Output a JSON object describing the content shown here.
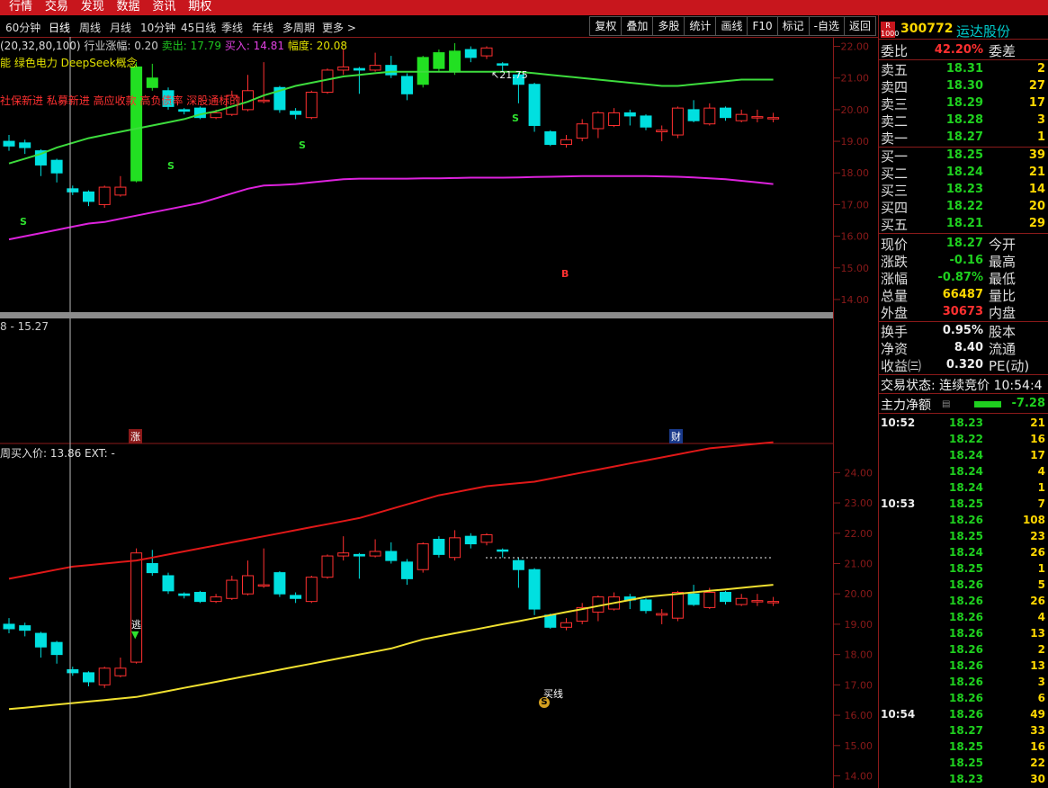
{
  "top_menu": [
    "行情",
    "交易",
    "发现",
    "数据",
    "资讯",
    "期权"
  ],
  "periods": [
    "60分钟",
    "日线",
    "周线",
    "月线",
    "10分钟",
    "45日线",
    "季线",
    "年线",
    "多周期",
    "更多 >"
  ],
  "active_period": "日线",
  "tools": [
    "复权",
    "叠加",
    "多股",
    "统计",
    "画线",
    "F10",
    "标记",
    "-自选",
    "返回"
  ],
  "indicator_line": {
    "params": "(20,32,80,100)",
    "industry_label": "行业涨幅: 0.20",
    "sell_label": "卖出: 17.79",
    "buy_label": "买入: 14.81",
    "range_label": "幅度: 20.08"
  },
  "concept_line": "能 绿色电力 DeepSeek概念",
  "tags_line": "社保新进 私募新进 高应收款 高负债率 深股通标的",
  "upper_low_label": "8 - 15.27",
  "lower_info": "周买入价: 13.86  EXT: -",
  "markers": {
    "high": "21.75",
    "s": "S",
    "b": "B",
    "zhang": "涨",
    "cai": "财",
    "tao": "逃",
    "mai": "买线",
    "low_s": "S"
  },
  "colors": {
    "up": "#ff3030",
    "down": "#00e0e0",
    "green_up": "#22e022",
    "ma_green": "#3ddc3d",
    "ma_magenta": "#dd22dd",
    "ma_red": "#e01818",
    "ma_yellow": "#f0e030",
    "axis": "#8b1a1a"
  },
  "upper_axis": {
    "ticks": [
      "22.00",
      "21.00",
      "20.00",
      "19.00",
      "18.00",
      "17.00",
      "16.00",
      "15.00",
      "14.00"
    ],
    "values": [
      22,
      21,
      20,
      19,
      18,
      17,
      16,
      15,
      14
    ]
  },
  "lower_axis": {
    "ticks": [
      "24.00",
      "23.00",
      "22.00",
      "21.00",
      "20.00",
      "19.00",
      "18.00",
      "17.00",
      "16.00",
      "15.00",
      "14.00"
    ],
    "values": [
      24,
      23,
      22,
      21,
      20,
      19,
      18,
      17,
      16,
      15,
      14
    ]
  },
  "chart_data": {
    "type": "candlestick",
    "upper_ylim": [
      13.6,
      22.3
    ],
    "lower_ylim": [
      13.6,
      24.9
    ],
    "candles": [
      [
        19.0,
        18.85,
        19.2,
        18.7
      ],
      [
        18.95,
        18.8,
        19.05,
        18.6
      ],
      [
        18.7,
        18.25,
        18.75,
        17.9
      ],
      [
        18.4,
        18.0,
        18.45,
        17.7
      ],
      [
        17.5,
        17.4,
        17.6,
        17.3
      ],
      [
        17.4,
        17.1,
        17.45,
        16.95
      ],
      [
        17.0,
        17.55,
        17.6,
        16.9
      ],
      [
        17.3,
        17.55,
        17.9,
        17.25
      ],
      [
        17.75,
        21.35,
        21.5,
        17.7
      ],
      [
        21.0,
        20.7,
        21.45,
        20.6
      ],
      [
        20.6,
        20.1,
        20.7,
        20.0
      ],
      [
        20.0,
        19.95,
        20.05,
        19.85
      ],
      [
        20.05,
        19.75,
        20.1,
        19.7
      ],
      [
        19.75,
        19.9,
        20.0,
        19.7
      ],
      [
        19.85,
        20.45,
        20.6,
        19.8
      ],
      [
        20.0,
        20.6,
        21.1,
        19.95
      ],
      [
        20.3,
        20.3,
        21.5,
        20.2
      ],
      [
        20.7,
        20.0,
        20.75,
        19.9
      ],
      [
        19.95,
        19.85,
        20.05,
        19.7
      ],
      [
        19.75,
        20.55,
        20.6,
        19.7
      ],
      [
        20.55,
        21.25,
        21.3,
        20.5
      ],
      [
        21.25,
        21.35,
        21.9,
        21.1
      ],
      [
        21.3,
        21.25,
        21.35,
        20.5
      ],
      [
        21.25,
        21.4,
        21.8,
        21.2
      ],
      [
        21.4,
        21.1,
        21.7,
        21.0
      ],
      [
        21.05,
        20.5,
        21.15,
        20.3
      ],
      [
        20.8,
        21.65,
        21.7,
        20.7
      ],
      [
        21.8,
        21.3,
        21.9,
        21.2
      ],
      [
        21.2,
        21.85,
        22.1,
        21.1
      ],
      [
        21.9,
        21.65,
        22.0,
        21.5
      ],
      [
        21.7,
        21.95,
        22.0,
        21.6
      ],
      [
        21.45,
        21.44,
        21.5,
        21.2
      ],
      [
        21.1,
        20.8,
        21.2,
        20.2
      ],
      [
        20.8,
        19.5,
        20.85,
        19.3
      ],
      [
        19.3,
        18.9,
        19.35,
        18.85
      ],
      [
        18.9,
        19.05,
        19.2,
        18.8
      ],
      [
        19.1,
        19.55,
        19.7,
        19.0
      ],
      [
        19.4,
        19.9,
        19.95,
        19.1
      ],
      [
        19.5,
        19.9,
        20.05,
        19.45
      ],
      [
        19.9,
        19.8,
        20.0,
        19.5
      ],
      [
        19.8,
        19.45,
        19.85,
        19.35
      ],
      [
        19.3,
        19.35,
        19.5,
        19.0
      ],
      [
        19.2,
        20.05,
        20.1,
        19.1
      ],
      [
        20.0,
        19.65,
        20.3,
        19.6
      ],
      [
        19.55,
        20.05,
        20.2,
        19.5
      ],
      [
        20.05,
        19.75,
        20.1,
        19.65
      ],
      [
        19.65,
        19.85,
        20.0,
        19.6
      ],
      [
        19.75,
        19.78,
        20.0,
        19.6
      ],
      [
        19.75,
        19.75,
        19.9,
        19.6
      ]
    ],
    "upper_ma_green": [
      18.3,
      18.45,
      18.6,
      18.8,
      18.95,
      19.1,
      19.2,
      19.3,
      19.4,
      19.5,
      19.6,
      19.7,
      19.85,
      19.95,
      20.1,
      20.25,
      20.45,
      20.6,
      20.75,
      20.85,
      20.95,
      21.05,
      21.1,
      21.15,
      21.2,
      21.2,
      21.2,
      21.2,
      21.2,
      21.2,
      21.2,
      21.2,
      21.2,
      21.15,
      21.1,
      21.05,
      21.0,
      20.95,
      20.9,
      20.85,
      20.8,
      20.75,
      20.75,
      20.8,
      20.85,
      20.9,
      20.95,
      20.95,
      20.95
    ],
    "upper_ma_magenta": [
      15.9,
      16.0,
      16.1,
      16.2,
      16.3,
      16.4,
      16.45,
      16.55,
      16.65,
      16.75,
      16.85,
      16.95,
      17.05,
      17.2,
      17.35,
      17.5,
      17.6,
      17.62,
      17.65,
      17.7,
      17.75,
      17.8,
      17.82,
      17.82,
      17.82,
      17.82,
      17.83,
      17.83,
      17.84,
      17.85,
      17.85,
      17.85,
      17.86,
      17.87,
      17.88,
      17.89,
      17.9,
      17.9,
      17.9,
      17.9,
      17.9,
      17.89,
      17.88,
      17.86,
      17.83,
      17.8,
      17.75,
      17.7,
      17.65
    ],
    "lower_ma_red": [
      20.5,
      20.6,
      20.7,
      20.8,
      20.9,
      20.95,
      21.0,
      21.05,
      21.1,
      21.2,
      21.3,
      21.4,
      21.5,
      21.6,
      21.7,
      21.8,
      21.9,
      22.0,
      22.1,
      22.2,
      22.3,
      22.4,
      22.5,
      22.65,
      22.8,
      22.95,
      23.1,
      23.25,
      23.35,
      23.45,
      23.55,
      23.6,
      23.65,
      23.7,
      23.8,
      23.9,
      24.0,
      24.1,
      24.2,
      24.3,
      24.4,
      24.5,
      24.6,
      24.7,
      24.8,
      24.85,
      24.9,
      24.95,
      25.0
    ],
    "lower_ma_yellow": [
      16.2,
      16.25,
      16.3,
      16.35,
      16.4,
      16.45,
      16.5,
      16.55,
      16.6,
      16.7,
      16.8,
      16.9,
      17.0,
      17.1,
      17.2,
      17.3,
      17.4,
      17.5,
      17.6,
      17.7,
      17.8,
      17.9,
      18.0,
      18.1,
      18.2,
      18.35,
      18.5,
      18.6,
      18.7,
      18.8,
      18.9,
      19.0,
      19.1,
      19.2,
      19.3,
      19.4,
      19.5,
      19.6,
      19.7,
      19.8,
      19.9,
      19.95,
      20.0,
      20.05,
      20.1,
      20.15,
      20.2,
      20.25,
      20.3
    ]
  },
  "quote": {
    "code": "300772",
    "name": "运达股份",
    "r_badge": "R 1000",
    "weibi": {
      "label": "委比",
      "value": "42.20%",
      "label2": "委差"
    },
    "asks": [
      {
        "label": "卖五",
        "price": "18.31",
        "vol": "2"
      },
      {
        "label": "卖四",
        "price": "18.30",
        "vol": "27"
      },
      {
        "label": "卖三",
        "price": "18.29",
        "vol": "17"
      },
      {
        "label": "卖二",
        "price": "18.28",
        "vol": "3"
      },
      {
        "label": "卖一",
        "price": "18.27",
        "vol": "1"
      }
    ],
    "bids": [
      {
        "label": "买一",
        "price": "18.25",
        "vol": "39"
      },
      {
        "label": "买二",
        "price": "18.24",
        "vol": "21"
      },
      {
        "label": "买三",
        "price": "18.23",
        "vol": "14"
      },
      {
        "label": "买四",
        "price": "18.22",
        "vol": "20"
      },
      {
        "label": "买五",
        "price": "18.21",
        "vol": "29"
      }
    ],
    "stats": [
      {
        "label": "现价",
        "value": "18.27",
        "cls": "green",
        "label2": "今开"
      },
      {
        "label": "涨跌",
        "value": "-0.16",
        "cls": "green",
        "label2": "最高"
      },
      {
        "label": "涨幅",
        "value": "-0.87%",
        "cls": "green",
        "label2": "最低"
      },
      {
        "label": "总量",
        "value": "66487",
        "cls": "yellow",
        "label2": "量比"
      },
      {
        "label": "外盘",
        "value": "30673",
        "cls": "red",
        "label2": "内盘"
      }
    ],
    "stats2": [
      {
        "label": "换手",
        "value": "0.95%",
        "label2": "股本"
      },
      {
        "label": "净资",
        "value": "8.40",
        "label2": "流通"
      },
      {
        "label": "收益㈢",
        "value": "0.320",
        "label2": "PE(动)"
      }
    ],
    "status": "交易状态: 连续竞价 10:54:4",
    "main_net": {
      "label": "主力净额",
      "value": "-7.28"
    },
    "ticks": [
      {
        "t": "10:52",
        "p": "18.23",
        "v": "21"
      },
      {
        "t": "",
        "p": "18.22",
        "v": "16"
      },
      {
        "t": "",
        "p": "18.24",
        "v": "17"
      },
      {
        "t": "",
        "p": "18.24",
        "v": "4"
      },
      {
        "t": "",
        "p": "18.24",
        "v": "1"
      },
      {
        "t": "10:53",
        "p": "18.25",
        "v": "7"
      },
      {
        "t": "",
        "p": "18.26",
        "v": "108"
      },
      {
        "t": "",
        "p": "18.25",
        "v": "23"
      },
      {
        "t": "",
        "p": "18.24",
        "v": "26"
      },
      {
        "t": "",
        "p": "18.25",
        "v": "1"
      },
      {
        "t": "",
        "p": "18.26",
        "v": "5"
      },
      {
        "t": "",
        "p": "18.26",
        "v": "26"
      },
      {
        "t": "",
        "p": "18.26",
        "v": "4"
      },
      {
        "t": "",
        "p": "18.26",
        "v": "13"
      },
      {
        "t": "",
        "p": "18.26",
        "v": "2"
      },
      {
        "t": "",
        "p": "18.26",
        "v": "13"
      },
      {
        "t": "",
        "p": "18.26",
        "v": "3"
      },
      {
        "t": "",
        "p": "18.26",
        "v": "6"
      },
      {
        "t": "10:54",
        "p": "18.26",
        "v": "49"
      },
      {
        "t": "",
        "p": "18.27",
        "v": "33"
      },
      {
        "t": "",
        "p": "18.25",
        "v": "16"
      },
      {
        "t": "",
        "p": "18.25",
        "v": "22"
      },
      {
        "t": "",
        "p": "18.23",
        "v": "30"
      }
    ]
  }
}
